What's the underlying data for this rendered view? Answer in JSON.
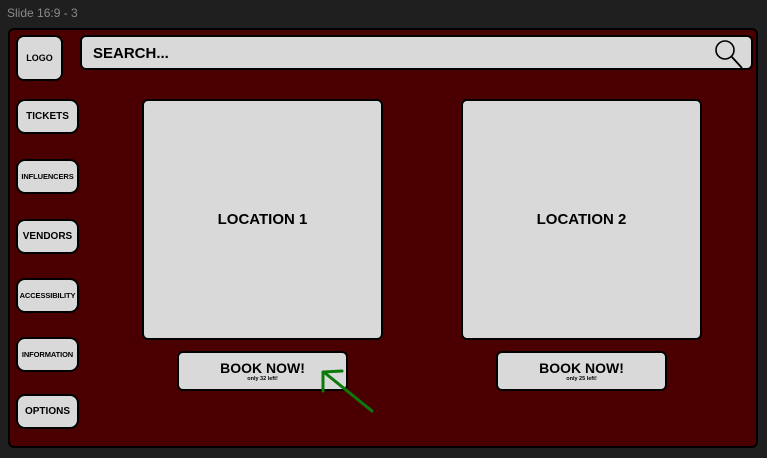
{
  "window": {
    "title": "Slide 16:9 - 3"
  },
  "logo": {
    "label": "LOGO"
  },
  "sidebar": {
    "items": [
      {
        "label": "TICKETS"
      },
      {
        "label": "INFLUENCERS"
      },
      {
        "label": "VENDORS"
      },
      {
        "label": "ACCESSIBILITY"
      },
      {
        "label": "INFORMATION"
      },
      {
        "label": "OPTIONS"
      }
    ]
  },
  "search": {
    "placeholder": "SEARCH...",
    "icon": "magnifier-icon"
  },
  "locations": [
    {
      "title": "LOCATION 1",
      "button_label": "BOOK NOW!",
      "availability": "only 32 left!"
    },
    {
      "title": "LOCATION 2",
      "button_label": "BOOK NOW!",
      "availability": "only 25 left!"
    }
  ],
  "colors": {
    "slide_background": "#4a0000",
    "panel_fill": "#d9d9d9",
    "annotation_arrow": "#0b7a0b"
  }
}
